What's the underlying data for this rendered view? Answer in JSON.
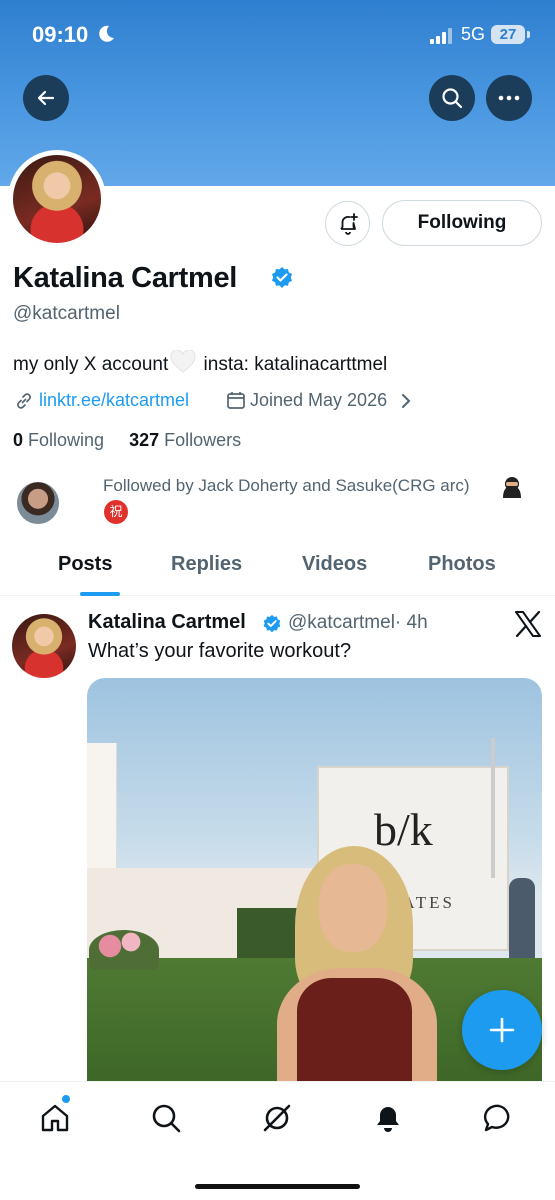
{
  "status_bar": {
    "time": "09:10",
    "network": "5G",
    "battery": "27"
  },
  "header": {
    "back_icon": "arrow-left-icon",
    "search_icon": "search-icon",
    "more_icon": "more-horizontal-icon"
  },
  "profile": {
    "name": "Katalina Cartmel",
    "handle": "@katcartmel",
    "bio_before": "my only X account",
    "bio_after": " insta: katalinacarttmel",
    "link": "linktr.ee/katcartmel",
    "joined": "Joined May 2026",
    "following_count": "0",
    "following_label": "Following",
    "followers_count": "327",
    "followers_label": "Followers",
    "followed_by": "Followed by Jack Doherty and Sasuke(CRG arc)",
    "follow_button": "Following"
  },
  "tabs": [
    {
      "label": "Posts",
      "active": true
    },
    {
      "label": "Replies",
      "active": false
    },
    {
      "label": "Videos",
      "active": false
    },
    {
      "label": "Photos",
      "active": false
    }
  ],
  "post": {
    "author": "Katalina Cartmel",
    "handle": "@katcartmel",
    "time": "· 4h",
    "text": "What’s your favorite workout?",
    "image_sign": "b/k",
    "image_sign_sub": "LATES"
  },
  "badge_glyph": "祝",
  "bottom_nav": [
    "home-icon",
    "search-icon",
    "grok-icon",
    "notifications-icon",
    "messages-icon"
  ],
  "colors": {
    "accent": "#1d9bf0",
    "banner": "#4a97e0",
    "text": "#0f1419",
    "muted": "#536471"
  }
}
